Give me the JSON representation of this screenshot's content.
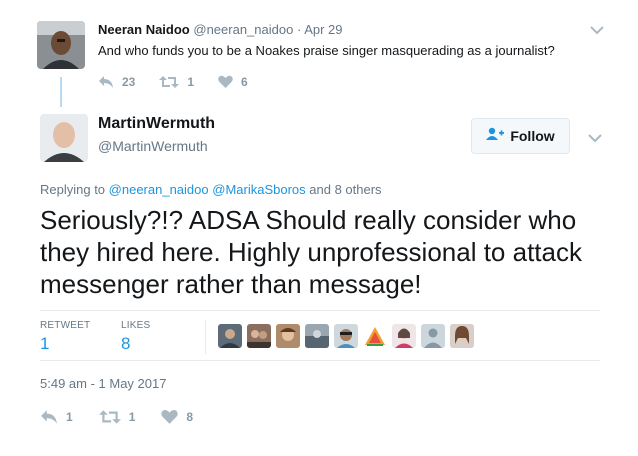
{
  "parent_tweet": {
    "display_name": "Neeran Naidoo",
    "handle": "@neeran_naidoo",
    "separator": "·",
    "date": "Apr 29",
    "text": "And who funds you to be a Noakes praise singer masquerading as a journalist?",
    "actions": {
      "reply_count": "23",
      "retweet_count": "1",
      "like_count": "6"
    }
  },
  "main_tweet": {
    "display_name": "MartinWermuth",
    "handle": "@MartinWermuth",
    "follow_label": "Follow",
    "replying_prefix": "Replying to",
    "replying_mention_1": "@neeran_naidoo",
    "replying_mention_2": "@MarikaSboros",
    "replying_suffix": "and 8 others",
    "text": "Seriously?!? ADSA Should really consider who they hired here. Highly unprofessional to attack messenger rather than message!",
    "stats": {
      "retweet_label": "RETWEET",
      "retweet_value": "1",
      "likes_label": "LIKES",
      "likes_value": "8"
    },
    "timestamp": "5:49 am - 1 May 2017",
    "actions": {
      "reply_count": "1",
      "retweet_count": "1",
      "like_count": "8"
    }
  },
  "colors": {
    "accent_link": "#1b95e0",
    "muted_text": "#657786",
    "action_icon": "#8899a6",
    "thread_line": "#b8dbf1"
  },
  "icons": [
    "reply-icon",
    "retweet-icon",
    "heart-icon",
    "chevron-down-icon",
    "follow-person-icon"
  ]
}
